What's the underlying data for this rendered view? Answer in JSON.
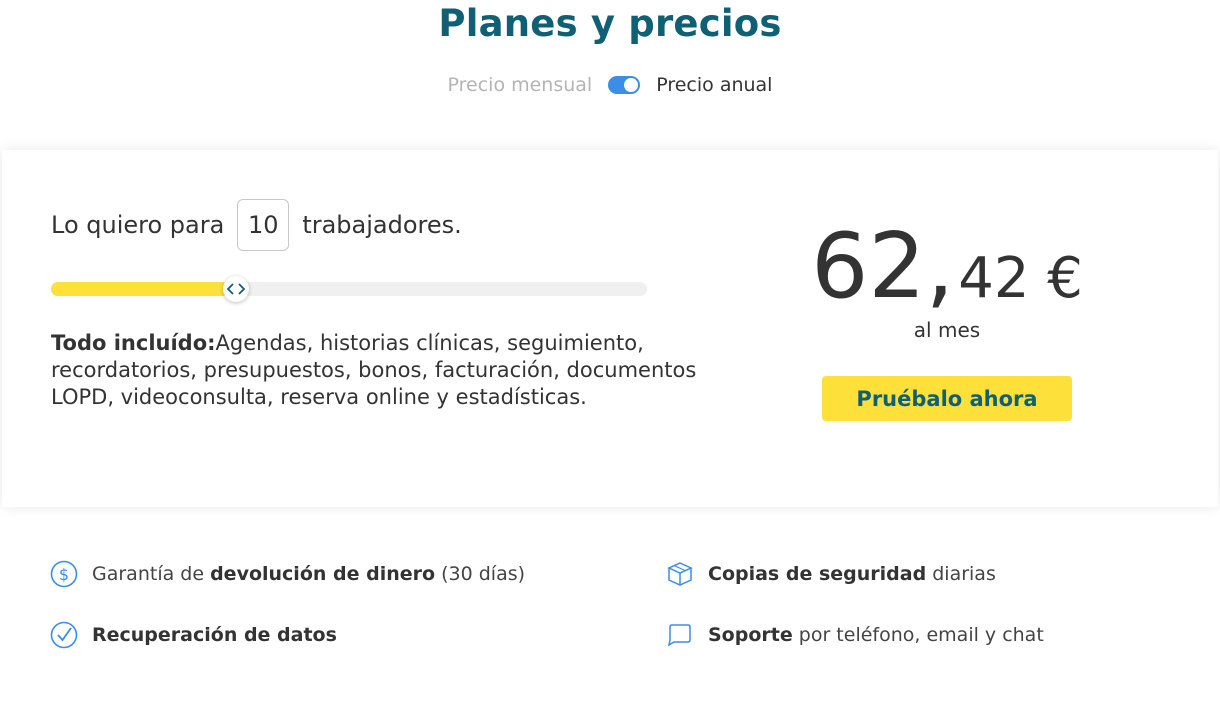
{
  "header": {
    "title": "Planes y precios",
    "toggle": {
      "monthly_label": "Precio mensual",
      "annual_label": "Precio anual",
      "annual_selected": true
    }
  },
  "calculator": {
    "prefix": "Lo quiero para",
    "workers": "10",
    "suffix": "trabajadores.",
    "slider_fraction": 0.31,
    "includes_bold": "Todo incluído:",
    "includes_text": "Agendas, historias clínicas, seguimiento, recordatorios, presupuestos, bonos, facturación, documentos LOPD, videoconsulta, reserva online y estadísticas."
  },
  "price": {
    "integer": "62,",
    "decimal": "42 €",
    "period": "al mes",
    "cta_label": "Pruébalo ahora"
  },
  "features": [
    {
      "icon": "dollar-circle-icon",
      "pre": "Garantía de ",
      "bold": "devolución de dinero",
      "post": " (30 días)"
    },
    {
      "icon": "box-icon",
      "pre": "",
      "bold": "Copias de seguridad",
      "post": " diarias"
    },
    {
      "icon": "check-circle-icon",
      "pre": "",
      "bold": "Recuperación de datos",
      "post": ""
    },
    {
      "icon": "chat-bubble-icon",
      "pre": "",
      "bold": "Soporte",
      "post": " por teléfono, email y chat"
    }
  ],
  "colors": {
    "title": "#0f5f75",
    "accent_yellow": "#fde03a",
    "toggle_blue": "#3b8ee6",
    "icon_blue": "#3b8ee6"
  }
}
